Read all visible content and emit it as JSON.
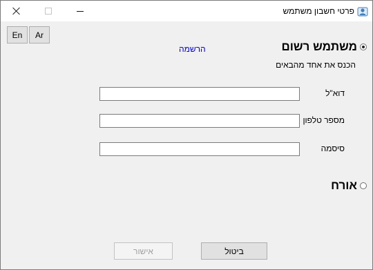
{
  "window": {
    "title": "פרטי חשבון משתמש",
    "app_icon": "user-account-icon",
    "controls": {
      "close": "close-icon",
      "maximize": "maximize-icon",
      "minimize": "minimize-icon"
    }
  },
  "language_buttons": {
    "en": "En",
    "ar": "Ar"
  },
  "registered_user": {
    "label": "משתמש רשום",
    "selected": true,
    "signup_link": "הרשמה",
    "hint": "הכנס את אחד מהבאים",
    "fields": {
      "email": {
        "label": "דוא\"ל",
        "value": ""
      },
      "phone": {
        "label": "מספר טלפון",
        "value": ""
      },
      "password": {
        "label": "סיסמה",
        "value": ""
      }
    }
  },
  "guest": {
    "label": "אורח",
    "selected": false
  },
  "buttons": {
    "confirm": "אישור",
    "cancel": "ביטול"
  },
  "colors": {
    "link": "#0000cc",
    "disabled_text": "#a0a0a0",
    "background": "#f0f0f0"
  }
}
